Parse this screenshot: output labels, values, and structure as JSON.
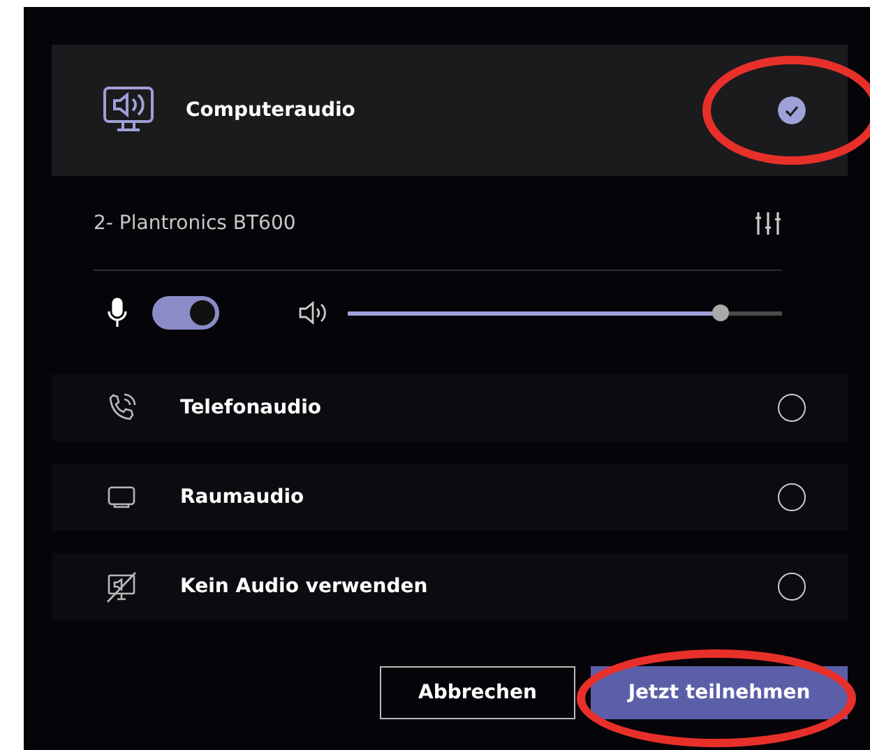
{
  "computer_audio": {
    "label": "Computeraudio",
    "selected": true,
    "circled": true
  },
  "device": {
    "name": "2- Plantronics BT600",
    "mic_on": true,
    "speaker": {
      "level": 0.86
    }
  },
  "options": [
    {
      "label": "Telefonaudio",
      "kind": "phone",
      "selected": false
    },
    {
      "label": "Raumaudio",
      "kind": "room",
      "selected": false
    },
    {
      "label": "Kein Audio verwenden",
      "kind": "none",
      "selected": false
    }
  ],
  "buttons": {
    "cancel": {
      "label": "Abbrechen"
    },
    "join": {
      "label": "Jetzt teilnehmen",
      "circled": true
    }
  }
}
